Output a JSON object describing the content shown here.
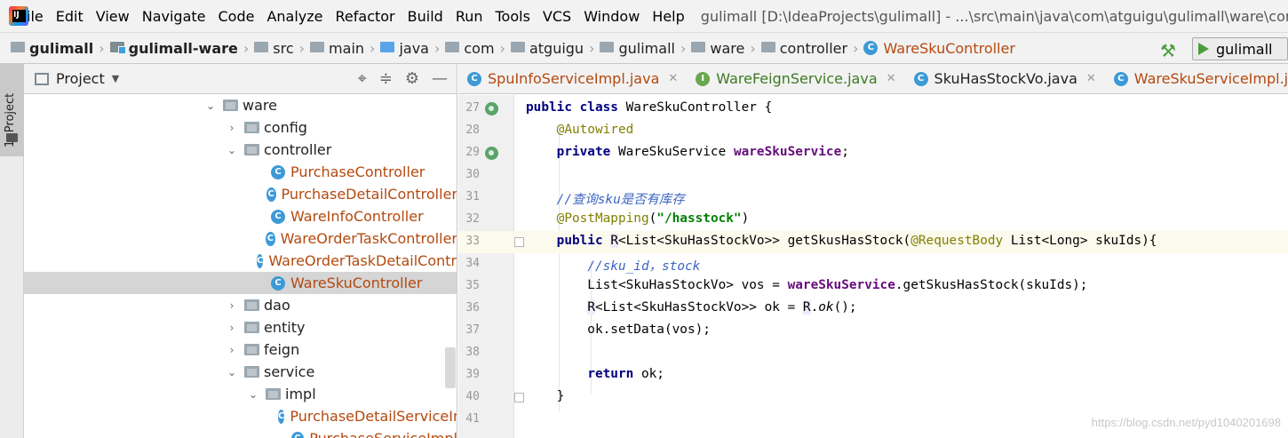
{
  "menubar": {
    "items": [
      "File",
      "Edit",
      "View",
      "Navigate",
      "Code",
      "Analyze",
      "Refactor",
      "Build",
      "Run",
      "Tools",
      "VCS",
      "Window",
      "Help"
    ],
    "window_title": "gulimall [D:\\IdeaProjects\\gulimall] - ...\\src\\main\\java\\com\\atguigu\\gulimall\\ware\\controller\\WareSkuController.java [gulimall-ware]"
  },
  "navbar": {
    "crumbs": [
      "gulimall",
      "gulimall-ware",
      "src",
      "main",
      "java",
      "com",
      "atguigu",
      "gulimall",
      "ware",
      "controller",
      "WareSkuController"
    ],
    "run_config": "gulimall"
  },
  "toolstrip": {
    "project_tab": "1: Project"
  },
  "project_panel": {
    "title": "Project",
    "tree": [
      {
        "label": "ware",
        "type": "folder",
        "expanded": true
      },
      {
        "label": "config",
        "type": "folder",
        "expanded": false
      },
      {
        "label": "controller",
        "type": "folder",
        "expanded": true
      },
      {
        "label": "PurchaseController",
        "type": "class"
      },
      {
        "label": "PurchaseDetailController",
        "type": "class"
      },
      {
        "label": "WareInfoController",
        "type": "class"
      },
      {
        "label": "WareOrderTaskController",
        "type": "class"
      },
      {
        "label": "WareOrderTaskDetailController",
        "type": "class"
      },
      {
        "label": "WareSkuController",
        "type": "class",
        "selected": true
      },
      {
        "label": "dao",
        "type": "folder",
        "expanded": false
      },
      {
        "label": "entity",
        "type": "folder",
        "expanded": false
      },
      {
        "label": "feign",
        "type": "folder",
        "expanded": false
      },
      {
        "label": "service",
        "type": "folder",
        "expanded": true
      },
      {
        "label": "impl",
        "type": "folder",
        "expanded": true
      },
      {
        "label": "PurchaseDetailServiceImpl",
        "type": "class"
      },
      {
        "label": "PurchaseServiceImpl",
        "type": "class"
      }
    ]
  },
  "editor_tabs": [
    {
      "label": "SpuInfoServiceImpl.java",
      "kind": "class"
    },
    {
      "label": "WareFeignService.java",
      "kind": "interface"
    },
    {
      "label": "SkuHasStockVo.java",
      "kind": "vo"
    },
    {
      "label": "WareSkuServiceImpl.java",
      "kind": "class"
    },
    {
      "label": "",
      "kind": "active"
    }
  ],
  "editor": {
    "lines": [
      {
        "num": "27",
        "text": "public class WareSkuController {"
      },
      {
        "num": "28",
        "text": "    @Autowired"
      },
      {
        "num": "29",
        "text": "    private WareSkuService wareSkuService;"
      },
      {
        "num": "30",
        "text": ""
      },
      {
        "num": "31",
        "text": "    //查询sku是否有库存"
      },
      {
        "num": "32",
        "text": "    @PostMapping(\"/hasstock\")"
      },
      {
        "num": "33",
        "text": "    public R<List<SkuHasStockVo>> getSkusHasStock(@RequestBody List<Long> skuIds){"
      },
      {
        "num": "34",
        "text": "        //sku_id，stock"
      },
      {
        "num": "35",
        "text": "        List<SkuHasStockVo> vos = wareSkuService.getSkusHasStock(skuIds);"
      },
      {
        "num": "36",
        "text": "        R<List<SkuHasStockVo>> ok = R.ok();"
      },
      {
        "num": "37",
        "text": "        ok.setData(vos);"
      },
      {
        "num": "38",
        "text": ""
      },
      {
        "num": "39",
        "text": "        return ok;"
      },
      {
        "num": "40",
        "text": "    }"
      },
      {
        "num": "41",
        "text": ""
      }
    ]
  },
  "watermark": "https://blog.csdn.net/pyd1040201698"
}
